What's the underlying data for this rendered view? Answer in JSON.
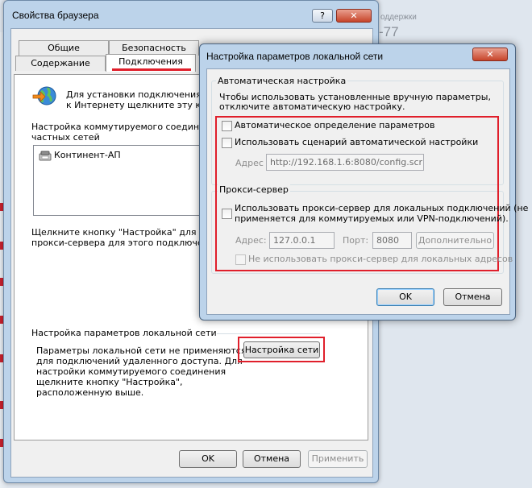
{
  "background": {
    "corner_text_1": "оддержки",
    "corner_text_2": "-77"
  },
  "main_window": {
    "title": "Свойства браузера",
    "help_glyph": "?",
    "close_glyph": "✕",
    "tabs_row1": [
      "Общие",
      "Безопасность"
    ],
    "tabs_row2": [
      "Содержание",
      "Подключения"
    ],
    "active_tab": "Подключения",
    "setup_text_1": "Для установки подключения",
    "setup_text_2": "к Интернету щелкните эту кноп",
    "dialup_header_1": "Настройка коммутируемого соединения",
    "dialup_header_2": "частных сетей",
    "dialup_items": [
      "Континент-АП"
    ],
    "proxy_hint_1": "Щелкните кнопку \"Настройка\" для наст",
    "proxy_hint_2": "прокси-сервера для этого подключени",
    "lan_section_title": "Настройка параметров локальной сети",
    "lan_desc": [
      "Параметры локальной сети не применяются",
      "для подключений удаленного доступа. Для",
      "настройки коммутируемого соединения",
      "щелкните кнопку \"Настройка\",",
      "расположенную выше."
    ],
    "lan_button": "Настройка сети",
    "ok": "OK",
    "cancel": "Отмена",
    "apply": "Применить"
  },
  "lan_dialog": {
    "title": "Настройка параметров локальной сети",
    "close_glyph": "✕",
    "auto_group": "Автоматическая настройка",
    "auto_desc_1": "Чтобы использовать установленные вручную параметры,",
    "auto_desc_2": "отключите автоматическую настройку.",
    "auto_detect": "Автоматическое определение параметров",
    "auto_detect_checked": false,
    "use_script": "Использовать сценарий автоматической настройки",
    "use_script_checked": false,
    "address_label": "Адрес",
    "address_value": "http://192.168.1.6:8080/config.script",
    "proxy_group": "Прокси-сервер",
    "use_proxy_1": "Использовать прокси-сервер для локальных подключений (не",
    "use_proxy_2": "применяется для коммутируемых или VPN-подключений).",
    "use_proxy_checked": false,
    "proxy_address_label": "Адрес:",
    "proxy_address_value": "127.0.0.1",
    "port_label": "Порт:",
    "port_value": "8080",
    "advanced": "Дополнительно",
    "bypass_local": "Не использовать прокси-сервер для локальных адресов",
    "bypass_local_checked": false,
    "ok": "OK",
    "cancel": "Отмена"
  },
  "colors": {
    "highlight_red": "#e01f2b",
    "titlebar": "#bcd3ea",
    "dialog_bg": "#f0f0f0"
  }
}
